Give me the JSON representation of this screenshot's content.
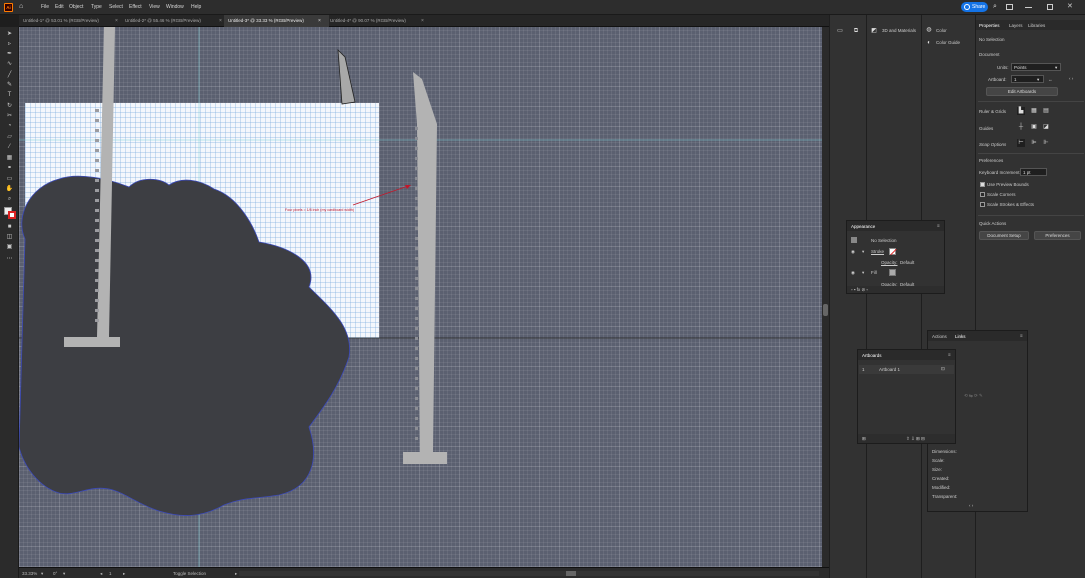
{
  "app": {
    "logo_text": "Ai"
  },
  "menu": [
    "File",
    "Edit",
    "Object",
    "Type",
    "Select",
    "Effect",
    "View",
    "Window",
    "Help"
  ],
  "header": {
    "share_label": "Share"
  },
  "tabs": [
    {
      "label": "Untitled-1* @ 53.01 % (RGB/Preview)",
      "active": false
    },
    {
      "label": "Untitled-2* @ 55.46 % (RGB/Preview)",
      "active": false
    },
    {
      "label": "Untitled-3* @ 33.33 % (RGB/Preview)",
      "active": true
    },
    {
      "label": "Untitled-4* @ 90.07 % (RGB/Preview)",
      "active": false
    }
  ],
  "canvas": {
    "annotation": "Four pixels = 1/8 inch (my cardboard width)"
  },
  "status": {
    "zoom": "33.33%",
    "rotation": "0°",
    "artboard_num": "1",
    "tool": "Toggle Selection"
  },
  "dock_mini": {
    "item1": "3D and Materials",
    "item2": "Color",
    "item3": "Color Guide"
  },
  "properties": {
    "tabs": [
      "Properties",
      "Layers",
      "Libraries"
    ],
    "selection": "No Selection",
    "document_heading": "Document",
    "units_label": "Units:",
    "units_value": "Points",
    "artboard_label": "Artboard:",
    "artboard_value": "1",
    "edit_artboards": "Edit Artboards",
    "ruler_grids": "Ruler & Grids",
    "guides": "Guides",
    "snap_options": "Snap Options",
    "preferences": "Preferences",
    "keyboard_increment_label": "Keyboard Increment:",
    "keyboard_increment_value": "1 pt",
    "use_preview_bounds": "Use Preview Bounds",
    "scale_corners": "Scale Corners",
    "scale_strokes": "Scale Strokes & Effects",
    "quick_actions": "Quick Actions",
    "document_setup": "Document Setup",
    "preferences_btn": "Preferences"
  },
  "appearance": {
    "title": "Appearance",
    "no_selection": "No Selection",
    "stroke": "Stroke",
    "opacity1_label": "Opacity:",
    "opacity1_value": "Default",
    "fill": "Fill",
    "opacity2_label": "Opacity:",
    "opacity2_value": "Default"
  },
  "links_panel": {
    "tabs": [
      "Actions",
      "Links"
    ],
    "fields": [
      "Dimensions:",
      "Scale:",
      "Size:",
      "Created:",
      "Modified:",
      "Transparent:"
    ]
  },
  "artboards_panel": {
    "title": "Artboards",
    "rows": [
      {
        "num": "1",
        "name": "Artboard 1"
      }
    ]
  }
}
